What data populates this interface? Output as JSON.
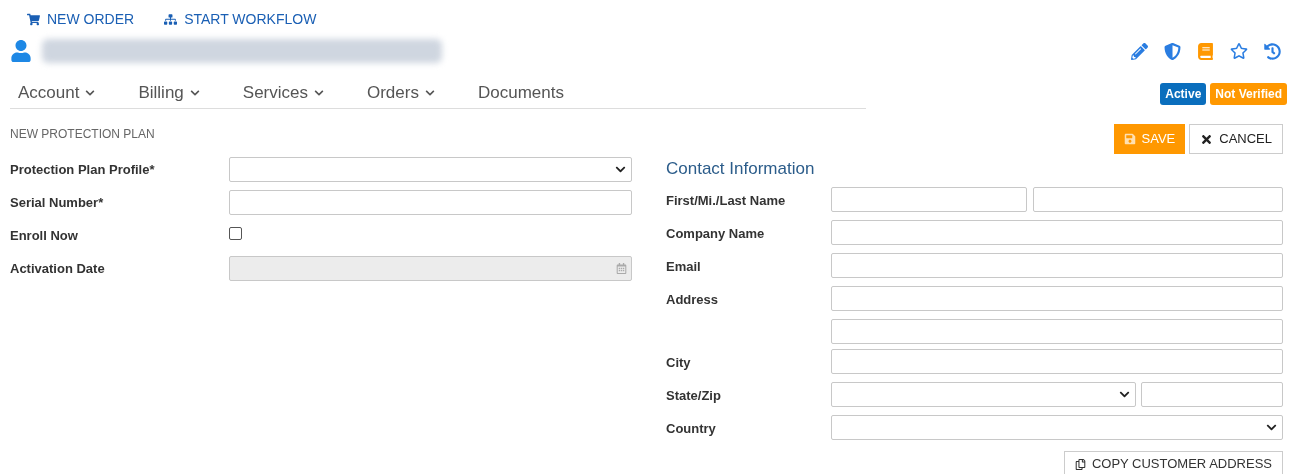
{
  "top_actions": [
    {
      "label": "NEW ORDER",
      "kind": "cart"
    },
    {
      "label": "START WORKFLOW",
      "kind": "workflow"
    }
  ],
  "header": {
    "tools": [
      {
        "kind": "edit"
      },
      {
        "kind": "alert"
      },
      {
        "kind": "book"
      },
      {
        "kind": "star"
      },
      {
        "kind": "history"
      }
    ]
  },
  "nav": [
    {
      "label": "Account",
      "dropdown": true
    },
    {
      "label": "Billing",
      "dropdown": true
    },
    {
      "label": "Services",
      "dropdown": true
    },
    {
      "label": "Orders",
      "dropdown": true
    },
    {
      "label": "Documents",
      "dropdown": false
    }
  ],
  "badges": [
    {
      "label": "Active",
      "color": "#0a6ebd"
    },
    {
      "label": "Not Verified",
      "color": "#ff9800"
    }
  ],
  "section_title": "NEW PROTECTION PLAN",
  "buttons": [
    {
      "label": "SAVE",
      "kind": "save"
    },
    {
      "label": "CANCEL",
      "kind": "cancel"
    }
  ],
  "plan_fields": [
    {
      "label": "Protection Plan Profile*",
      "kind": "select"
    },
    {
      "label": "Serial Number*",
      "kind": "text"
    },
    {
      "label": "Enroll Now",
      "kind": "checkbox",
      "checked": false
    },
    {
      "label": "Activation Date",
      "kind": "date",
      "disabled": true
    }
  ],
  "contact": {
    "title": "Contact Information",
    "rows": [
      {
        "label": "First/Mi./Last Name",
        "kind": "name"
      },
      {
        "label": "Company Name",
        "kind": "single"
      },
      {
        "label": "Email",
        "kind": "single"
      },
      {
        "label": "Address",
        "kind": "single"
      },
      {
        "kind": "single"
      },
      {
        "label": "City",
        "kind": "single"
      },
      {
        "label": "State/Zip",
        "kind": "state_zip"
      },
      {
        "label": "Country",
        "kind": "select"
      }
    ],
    "copy_button": "COPY CUSTOMER ADDRESS"
  }
}
